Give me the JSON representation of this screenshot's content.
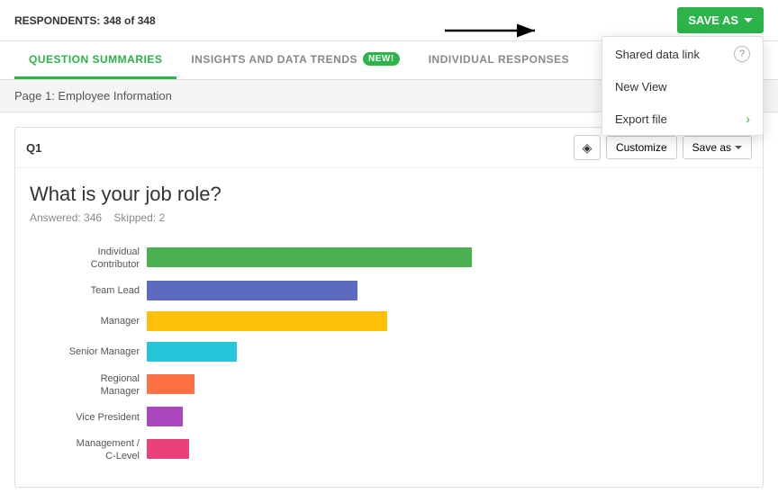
{
  "topbar": {
    "respondents_label": "RESPONDENTS: 348 of 348",
    "save_as_label": "SAVE AS"
  },
  "tabs": [
    {
      "id": "question-summaries",
      "label": "QUESTION SUMMARIES",
      "active": true
    },
    {
      "id": "insights-and-data-trends",
      "label": "INSIGHTS AND DATA TRENDS",
      "active": false,
      "badge": "NEW!"
    },
    {
      "id": "individual-responses",
      "label": "INDIVIDUAL RESPONSES",
      "active": false
    }
  ],
  "page_label": "Page 1: Employee Information",
  "question": {
    "number": "Q1",
    "title": "What is your job role?",
    "answered": "Answered: 346",
    "skipped": "Skipped: 2",
    "customize_label": "Customize",
    "save_as_label": "Save as"
  },
  "chart": {
    "bars": [
      {
        "label": "Individual\nContributor",
        "color": "#4caf50",
        "width_pct": 54
      },
      {
        "label": "Team Lead",
        "color": "#5c6bc0",
        "width_pct": 35
      },
      {
        "label": "Manager",
        "color": "#ffc107",
        "width_pct": 40
      },
      {
        "label": "Senior Manager",
        "color": "#26c6da",
        "width_pct": 15
      },
      {
        "label": "Regional\nManager",
        "color": "#ff7043",
        "width_pct": 8
      },
      {
        "label": "Vice President",
        "color": "#ab47bc",
        "width_pct": 6
      },
      {
        "label": "Management /\nC-Level",
        "color": "#ec407a",
        "width_pct": 7
      }
    ]
  },
  "dropdown": {
    "items": [
      {
        "label": "Shared data link",
        "has_help": true
      },
      {
        "label": "New View",
        "has_help": false
      },
      {
        "label": "Export file",
        "has_chevron": true
      }
    ]
  }
}
